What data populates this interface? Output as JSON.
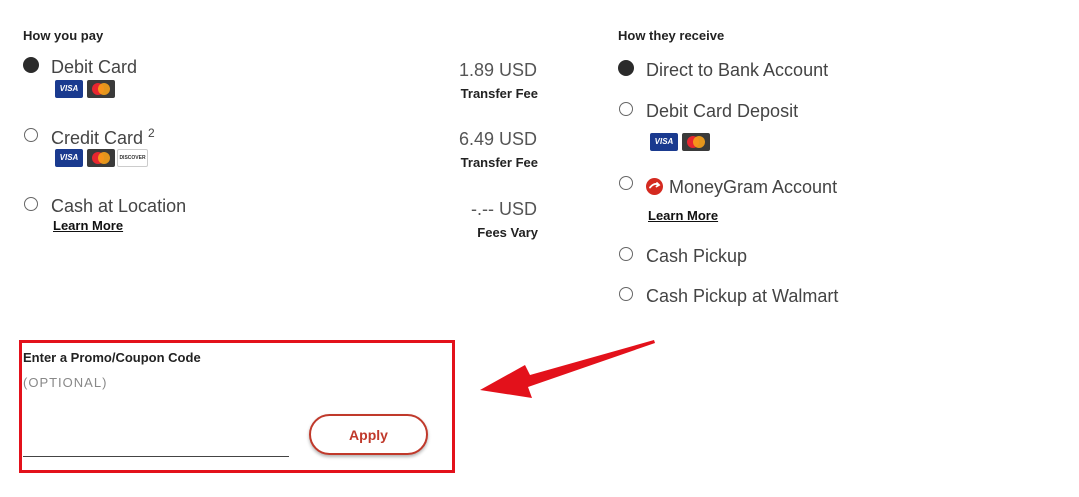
{
  "pay": {
    "heading": "How you pay",
    "options": [
      {
        "label": "Debit Card",
        "selected": true,
        "price": "1.89 USD",
        "price_sub": "Transfer Fee"
      },
      {
        "label": "Credit Card",
        "sup": "2",
        "selected": false,
        "price": "6.49 USD",
        "price_sub": "Transfer Fee"
      },
      {
        "label": "Cash at Location",
        "selected": false,
        "link": "Learn More",
        "price": "-.-- USD",
        "price_sub": "Fees Vary"
      }
    ],
    "card_logos": {
      "visa": "VISA",
      "discover": "DISCOVER"
    }
  },
  "receive": {
    "heading": "How they receive",
    "options": [
      {
        "label": "Direct to Bank Account",
        "selected": true
      },
      {
        "label": "Debit Card Deposit",
        "selected": false
      },
      {
        "label": "MoneyGram Account",
        "selected": false,
        "link": "Learn More",
        "icon": "moneygram-logo-icon"
      },
      {
        "label": "Cash Pickup",
        "selected": false
      },
      {
        "label": "Cash Pickup at Walmart",
        "selected": false
      }
    ]
  },
  "promo": {
    "label": "Enter a Promo/Coupon Code",
    "optional": "(OPTIONAL)",
    "value": "",
    "button": "Apply"
  },
  "colors": {
    "highlight": "#e3111b",
    "accent": "#c0392b",
    "selected_radio": "#2b2b2b"
  }
}
